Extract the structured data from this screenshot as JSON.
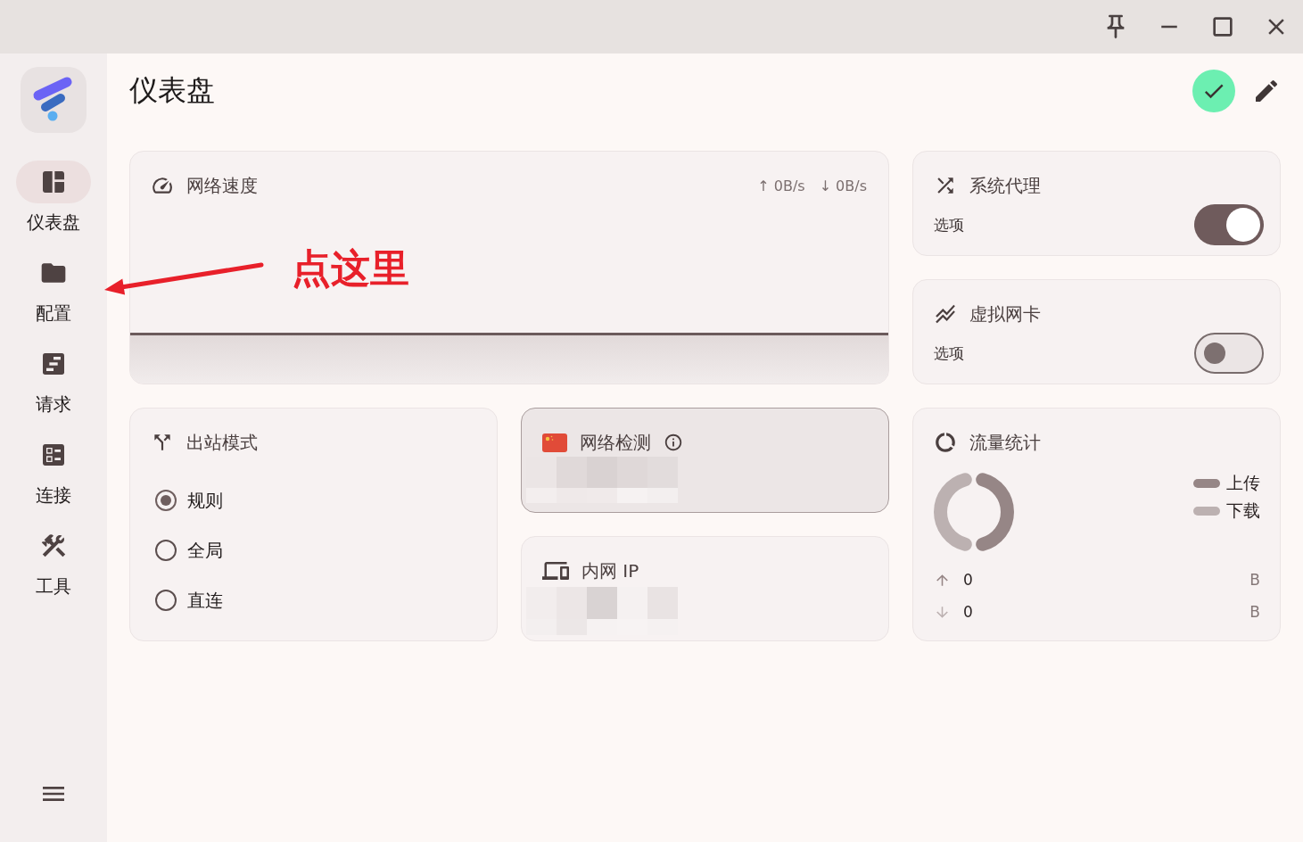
{
  "sidebar": {
    "items": [
      {
        "kind": "dashboard",
        "label": "仪表盘",
        "selected": true
      },
      {
        "kind": "profiles",
        "label": "配置",
        "selected": false
      },
      {
        "kind": "requests",
        "label": "请求",
        "selected": false
      },
      {
        "kind": "connections",
        "label": "连接",
        "selected": false
      },
      {
        "kind": "tools",
        "label": "工具",
        "selected": false
      }
    ]
  },
  "header": {
    "title": "仪表盘",
    "running": true
  },
  "network_speed": {
    "title": "网络速度",
    "upload": "↑ 0B/s",
    "download": "↓ 0B/s"
  },
  "annotation": {
    "text": "点这里"
  },
  "system_proxy": {
    "title": "系统代理",
    "label": "选项",
    "on": true
  },
  "virtual_nic": {
    "title": "虚拟网卡",
    "label": "选项",
    "on": false
  },
  "outbound_mode": {
    "title": "出站模式",
    "options": [
      {
        "label": "规则",
        "selected": true
      },
      {
        "label": "全局",
        "selected": false
      },
      {
        "label": "直连",
        "selected": false
      }
    ]
  },
  "network_check": {
    "title": "网络检测",
    "focused": true
  },
  "intranet_ip": {
    "title": "内网 IP"
  },
  "traffic": {
    "title": "流量统计",
    "legend": [
      {
        "label": "上传",
        "color": "#968686"
      },
      {
        "label": "下载",
        "color": "#bcb1b1"
      }
    ],
    "rows": [
      {
        "value": "0",
        "unit": "B"
      },
      {
        "value": "0",
        "unit": "B"
      }
    ]
  }
}
